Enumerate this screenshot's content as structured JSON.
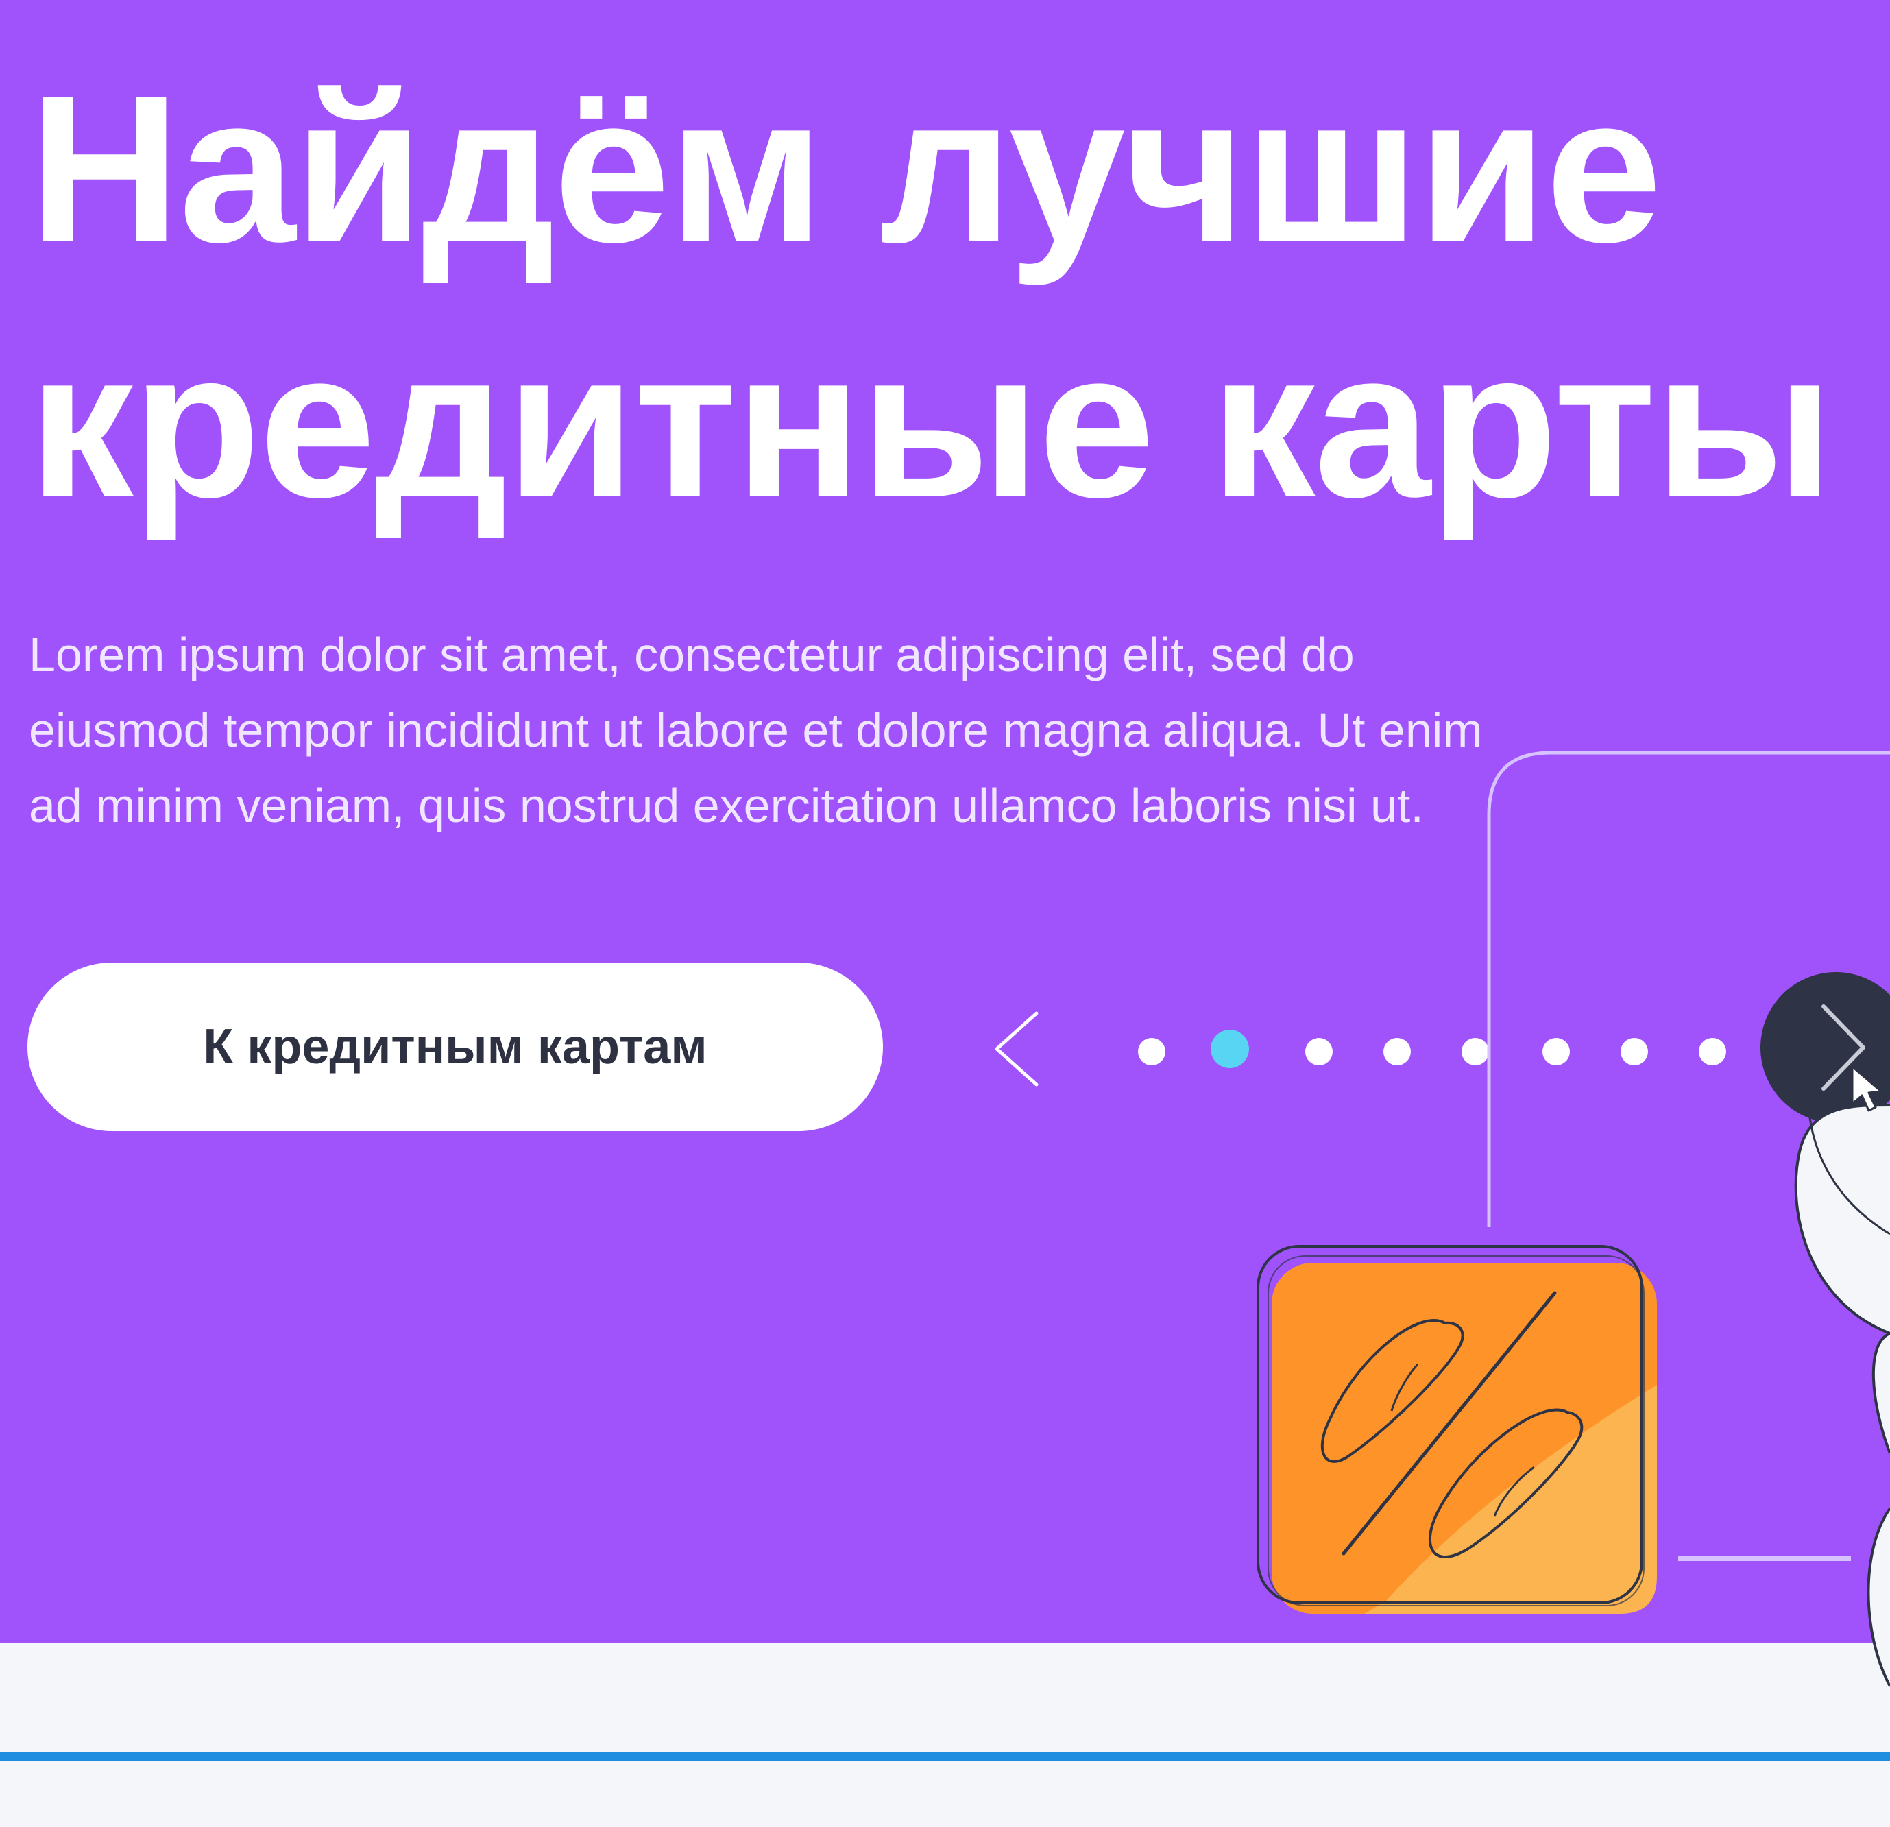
{
  "hero": {
    "title_lines": [
      "Найдём лучшие",
      "кредитные карты"
    ],
    "description_lines": [
      "Lorem ipsum dolor sit amet, consectetur adipiscing elit, sed do",
      "eiusmod tempor incididunt ut labore et dolore magna aliqua. Ut enim",
      "ad minim veniam, quis nostrud exercitation ullamco laboris nisi ut."
    ],
    "cta_label": "К кредитным картам",
    "background_color": "#a052fb"
  },
  "slider": {
    "prev_icon": "chevron-left-icon",
    "next_icon": "chevron-right-icon",
    "dot_count": 8,
    "active_dot": 2,
    "active_color": "#58d5f2"
  },
  "illustration": {
    "icon": "percent-icon",
    "card_color": "#fe9429"
  },
  "footer": {
    "accent_line_color": "#1f8ee0"
  }
}
